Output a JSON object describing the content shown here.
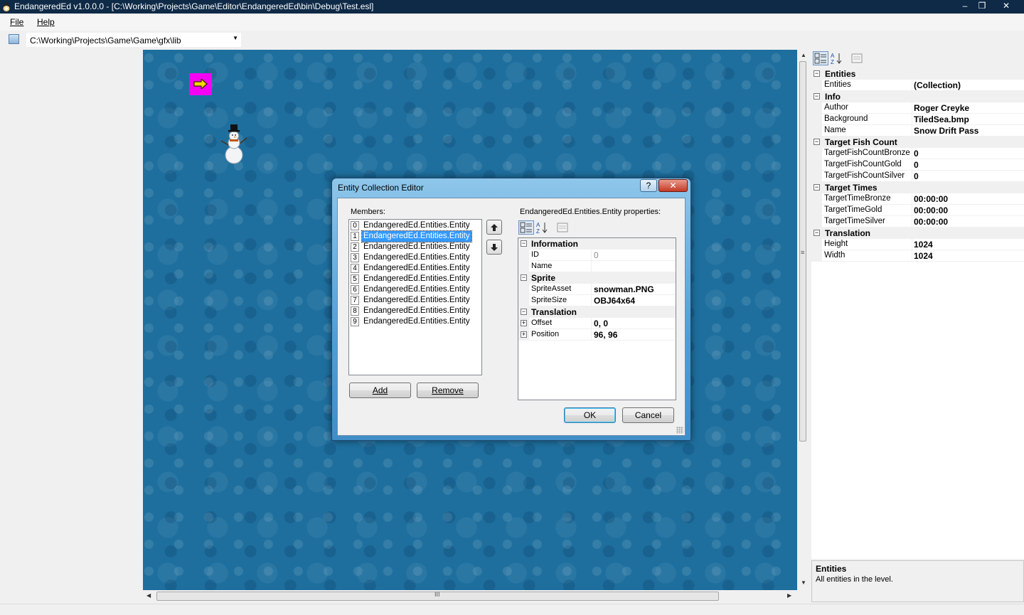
{
  "window": {
    "title": "EndangeredEd v1.0.0.0 - [C:\\Working\\Projects\\Game\\Editor\\EndangeredEd\\bin\\Debug\\Test.esl]",
    "controls": {
      "minimize": "–",
      "restore": "❐",
      "close": "✕"
    }
  },
  "menu": {
    "file": "File",
    "help": "Help"
  },
  "toolbar": {
    "path": "C:\\Working\\Projects\\Game\\Game\\gfx\\lib"
  },
  "canvas": {
    "grip_v": "≡",
    "grip_h": "III"
  },
  "propgrid": {
    "rows": [
      {
        "type": "cat",
        "label": "Entities"
      },
      {
        "type": "prop",
        "name": "Entities",
        "value": "(Collection)"
      },
      {
        "type": "cat",
        "label": "Info"
      },
      {
        "type": "prop",
        "name": "Author",
        "value": "Roger Creyke"
      },
      {
        "type": "prop",
        "name": "Background",
        "value": "TiledSea.bmp"
      },
      {
        "type": "prop",
        "name": "Name",
        "value": "Snow Drift Pass"
      },
      {
        "type": "cat",
        "label": "Target Fish Count"
      },
      {
        "type": "prop",
        "name": "TargetFishCountBronze",
        "value": "0"
      },
      {
        "type": "prop",
        "name": "TargetFishCountGold",
        "value": "0"
      },
      {
        "type": "prop",
        "name": "TargetFishCountSilver",
        "value": "0"
      },
      {
        "type": "cat",
        "label": "Target Times"
      },
      {
        "type": "prop",
        "name": "TargetTimeBronze",
        "value": "00:00:00"
      },
      {
        "type": "prop",
        "name": "TargetTimeGold",
        "value": "00:00:00"
      },
      {
        "type": "prop",
        "name": "TargetTimeSilver",
        "value": "00:00:00"
      },
      {
        "type": "cat",
        "label": "Translation"
      },
      {
        "type": "prop",
        "name": "Height",
        "value": "1024"
      },
      {
        "type": "prop",
        "name": "Width",
        "value": "1024"
      }
    ],
    "help_title": "Entities",
    "help_desc": "All entities in the level."
  },
  "dialog": {
    "title": "Entity Collection Editor",
    "help_glyph": "?",
    "close_glyph": "✕",
    "members_label": "Members:",
    "members": [
      {
        "index": "0",
        "label": "EndangeredEd.Entities.Entity",
        "selected": false
      },
      {
        "index": "1",
        "label": "EndangeredEd.Entities.Entity",
        "selected": true
      },
      {
        "index": "2",
        "label": "EndangeredEd.Entities.Entity",
        "selected": false
      },
      {
        "index": "3",
        "label": "EndangeredEd.Entities.Entity",
        "selected": false
      },
      {
        "index": "4",
        "label": "EndangeredEd.Entities.Entity",
        "selected": false
      },
      {
        "index": "5",
        "label": "EndangeredEd.Entities.Entity",
        "selected": false
      },
      {
        "index": "6",
        "label": "EndangeredEd.Entities.Entity",
        "selected": false
      },
      {
        "index": "7",
        "label": "EndangeredEd.Entities.Entity",
        "selected": false
      },
      {
        "index": "8",
        "label": "EndangeredEd.Entities.Entity",
        "selected": false
      },
      {
        "index": "9",
        "label": "EndangeredEd.Entities.Entity",
        "selected": false
      }
    ],
    "move_up": "🡡",
    "move_down": "🡣",
    "add": "Add",
    "remove": "Remove",
    "properties_label": "EndangeredEd.Entities.Entity properties:",
    "props": [
      {
        "type": "cat",
        "label": "Information"
      },
      {
        "type": "prop",
        "name": "ID",
        "value": "0",
        "readonly": true
      },
      {
        "type": "prop",
        "name": "Name",
        "value": ""
      },
      {
        "type": "cat",
        "label": "Sprite"
      },
      {
        "type": "prop",
        "name": "SpriteAsset",
        "value": "snowman.PNG"
      },
      {
        "type": "prop",
        "name": "SpriteSize",
        "value": "OBJ64x64"
      },
      {
        "type": "cat",
        "label": "Translation"
      },
      {
        "type": "prop",
        "name": "Offset",
        "value": "0, 0",
        "expandable": true
      },
      {
        "type": "prop",
        "name": "Position",
        "value": "96, 96",
        "expandable": true
      }
    ],
    "ok": "OK",
    "cancel": "Cancel"
  },
  "colors": {
    "titlebar": "#0e2a47",
    "canvas": "#1e6f9e",
    "marker": "#f600f6",
    "selection": "#3399ff"
  }
}
